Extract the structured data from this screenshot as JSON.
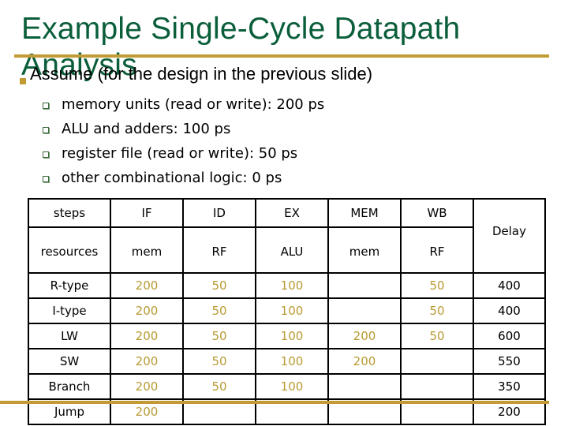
{
  "slide": {
    "title_line1": "Example Single-Cycle Datapath",
    "title_line2": "Analysis",
    "accent_color": "#c39b34",
    "title_color": "#0b5e3a",
    "value_color": "#b89a32"
  },
  "bullets": {
    "main": "Assume (for the design in the previous slide)",
    "sub": [
      "memory units (read or write): 200 ps",
      "ALU and adders: 100 ps",
      "register file (read or write): 50 ps",
      "other combinational logic: 0 ps"
    ]
  },
  "table": {
    "steps_label": "steps",
    "resources_label": "resources",
    "delay_label": "Delay",
    "steps": [
      "IF",
      "ID",
      "EX",
      "MEM",
      "WB"
    ],
    "resources": [
      "mem",
      "RF",
      "ALU",
      "mem",
      "RF"
    ],
    "rows": [
      {
        "name": "R-type",
        "values": [
          "200",
          "50",
          "100",
          "",
          "50"
        ],
        "delay": "400"
      },
      {
        "name": "I-type",
        "values": [
          "200",
          "50",
          "100",
          "",
          "50"
        ],
        "delay": "400"
      },
      {
        "name": "LW",
        "values": [
          "200",
          "50",
          "100",
          "200",
          "50"
        ],
        "delay": "600"
      },
      {
        "name": "SW",
        "values": [
          "200",
          "50",
          "100",
          "200",
          ""
        ],
        "delay": "550"
      },
      {
        "name": "Branch",
        "values": [
          "200",
          "50",
          "100",
          "",
          ""
        ],
        "delay": "350"
      },
      {
        "name": "Jump",
        "values": [
          "200",
          "",
          "",
          "",
          ""
        ],
        "delay": "200"
      }
    ]
  }
}
